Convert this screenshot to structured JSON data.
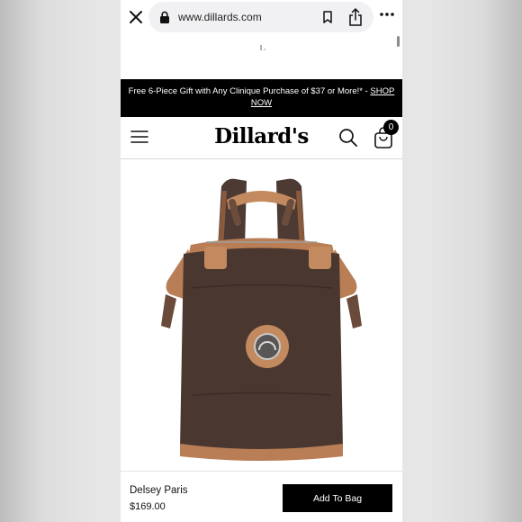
{
  "browser": {
    "url": "www.dillards.com",
    "icons": [
      "close-icon",
      "lock-icon",
      "bookmark-icon",
      "share-icon",
      "more-icon"
    ]
  },
  "promo": {
    "text": "Free 6-Piece Gift with Any Clinique Purchase of $37 or More!* - ",
    "link": "SHOP NOW"
  },
  "header": {
    "logo": "Dillard's",
    "cart_count": "0",
    "icons": [
      "menu-icon",
      "search-icon",
      "shopping-bag-icon"
    ]
  },
  "product": {
    "brand": "Delsey Paris",
    "price": "$169.00",
    "add_to_bag_label": "Add To Bag"
  },
  "colors": {
    "promo_bg": "#000000",
    "button_bg": "#000000",
    "bag_body": "#4a3730",
    "bag_trim": "#b97e55"
  }
}
